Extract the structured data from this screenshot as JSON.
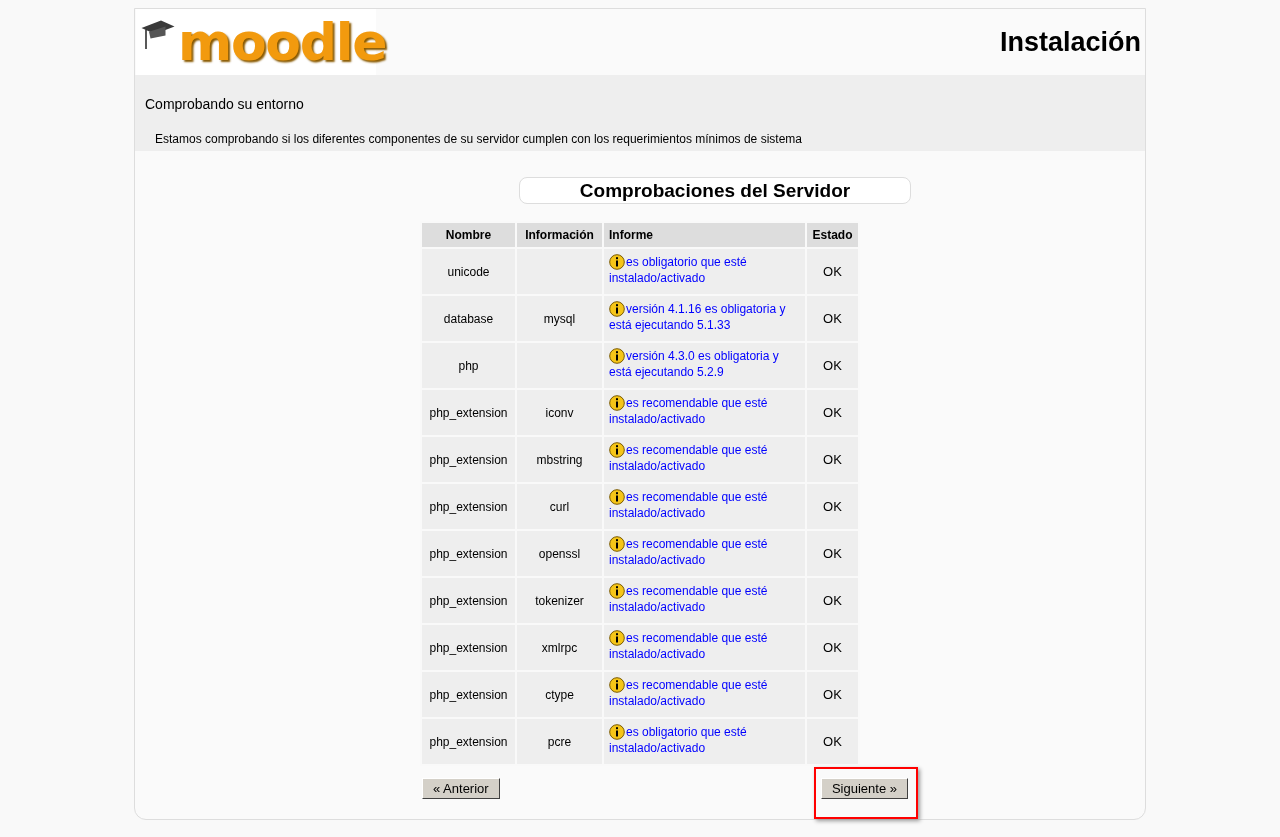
{
  "header": {
    "logo": "moodle",
    "title": "Instalación"
  },
  "intro": {
    "heading": "Comprobando su entorno",
    "text": "Estamos comprobando si los diferentes componentes de su servidor cumplen con los requerimientos mínimos de sistema"
  },
  "checks": {
    "title": "Comprobaciones del Servidor",
    "columns": [
      "Nombre",
      "Información",
      "Informe",
      "Estado"
    ],
    "rows": [
      {
        "name": "unicode",
        "info": "",
        "report": "es obligatorio que esté instalado/activado",
        "status": "OK"
      },
      {
        "name": "database",
        "info": "mysql",
        "report": "versión 4.1.16 es obligatoria y está ejecutando 5.1.33",
        "status": "OK"
      },
      {
        "name": "php",
        "info": "",
        "report": "versión 4.3.0 es obligatoria y está ejecutando 5.2.9",
        "status": "OK"
      },
      {
        "name": "php_extension",
        "info": "iconv",
        "report": "es recomendable que esté instalado/activado",
        "status": "OK"
      },
      {
        "name": "php_extension",
        "info": "mbstring",
        "report": "es recomendable que esté instalado/activado",
        "status": "OK"
      },
      {
        "name": "php_extension",
        "info": "curl",
        "report": "es recomendable que esté instalado/activado",
        "status": "OK"
      },
      {
        "name": "php_extension",
        "info": "openssl",
        "report": "es recomendable que esté instalado/activado",
        "status": "OK"
      },
      {
        "name": "php_extension",
        "info": "tokenizer",
        "report": "es recomendable que esté instalado/activado",
        "status": "OK"
      },
      {
        "name": "php_extension",
        "info": "xmlrpc",
        "report": "es recomendable que esté instalado/activado",
        "status": "OK"
      },
      {
        "name": "php_extension",
        "info": "ctype",
        "report": "es recomendable que esté instalado/activado",
        "status": "OK"
      },
      {
        "name": "php_extension",
        "info": "pcre",
        "report": "es obligatorio que esté instalado/activado",
        "status": "OK"
      }
    ]
  },
  "buttons": [
    {
      "label": "« Anterior",
      "highlighted": false
    },
    {
      "label": "Siguiente »",
      "highlighted": true
    }
  ]
}
